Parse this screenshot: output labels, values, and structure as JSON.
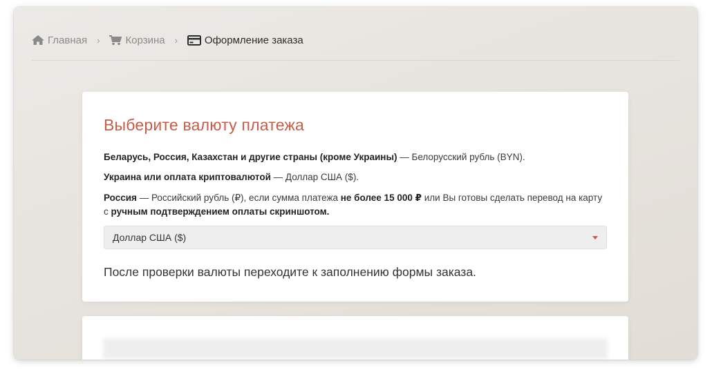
{
  "breadcrumb": {
    "home": {
      "label": "Главная",
      "icon": "home-icon"
    },
    "cart": {
      "label": "Корзина",
      "icon": "cart-icon"
    },
    "checkout": {
      "label": "Оформление заказа",
      "icon": "credit-card-icon"
    },
    "separator": "›"
  },
  "currency_card": {
    "title": "Выберите валюту платежа",
    "line1": {
      "bold": "Беларусь, Россия, Казахстан и другие страны (кроме Украины)",
      "text": " — Белорусский рубль (BYN)."
    },
    "line2": {
      "bold": "Украина или оплата криптовалютой",
      "text": " — Доллар США ($)."
    },
    "line3": {
      "bold1": "Россия",
      "text1": " — Российский рубль (₽), если сумма платежа ",
      "bold2": "не более 15 000 ₽",
      "text2": " или Вы готовы сделать перевод на карту с ",
      "bold3": "ручным подтверждением оплаты скриншотом."
    },
    "select_value": "Доллар США ($)",
    "note": "После проверки валюты переходите к заполнению формы заказа."
  },
  "colors": {
    "accent": "#c65c48"
  }
}
